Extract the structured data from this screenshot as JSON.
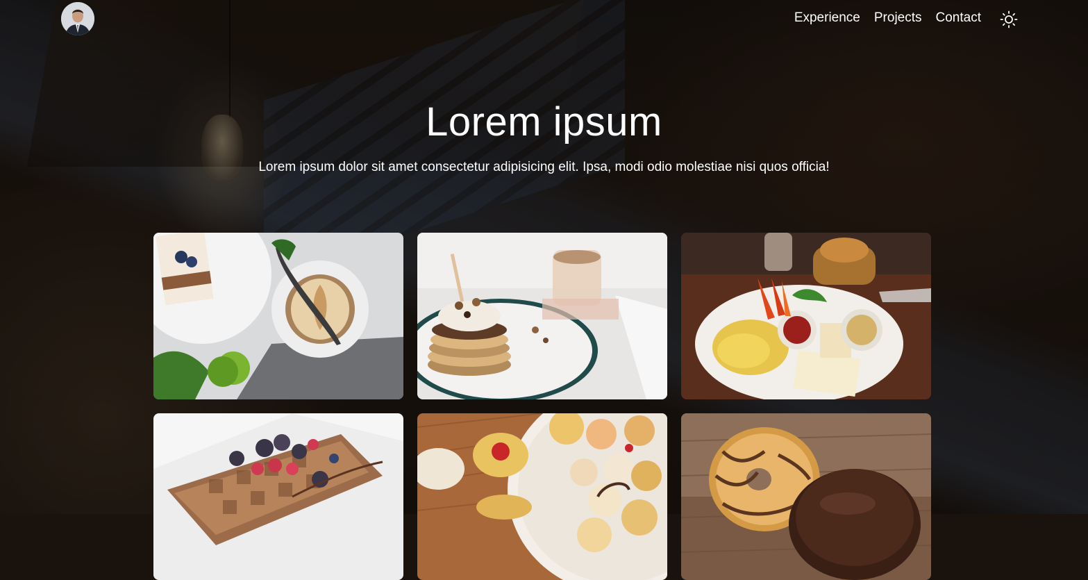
{
  "nav": {
    "experience": "Experience",
    "projects": "Projects",
    "contact": "Contact"
  },
  "hero": {
    "title": "Lorem ipsum",
    "subtitle": "Lorem ipsum dolor sit amet consectetur adipisicing elit. Ipsa, modi odio molestiae nisi quos officia!"
  },
  "gallery": {
    "items": [
      {
        "icon": "cake-and-latte-photo"
      },
      {
        "icon": "pancake-stack-photo"
      },
      {
        "icon": "breakfast-plate-photo"
      },
      {
        "icon": "waffle-with-berries-photo"
      },
      {
        "icon": "cookies-plate-photo"
      },
      {
        "icon": "donuts-photo"
      }
    ]
  },
  "colors": {
    "text": "#ffffff",
    "overlay": "#000000"
  }
}
